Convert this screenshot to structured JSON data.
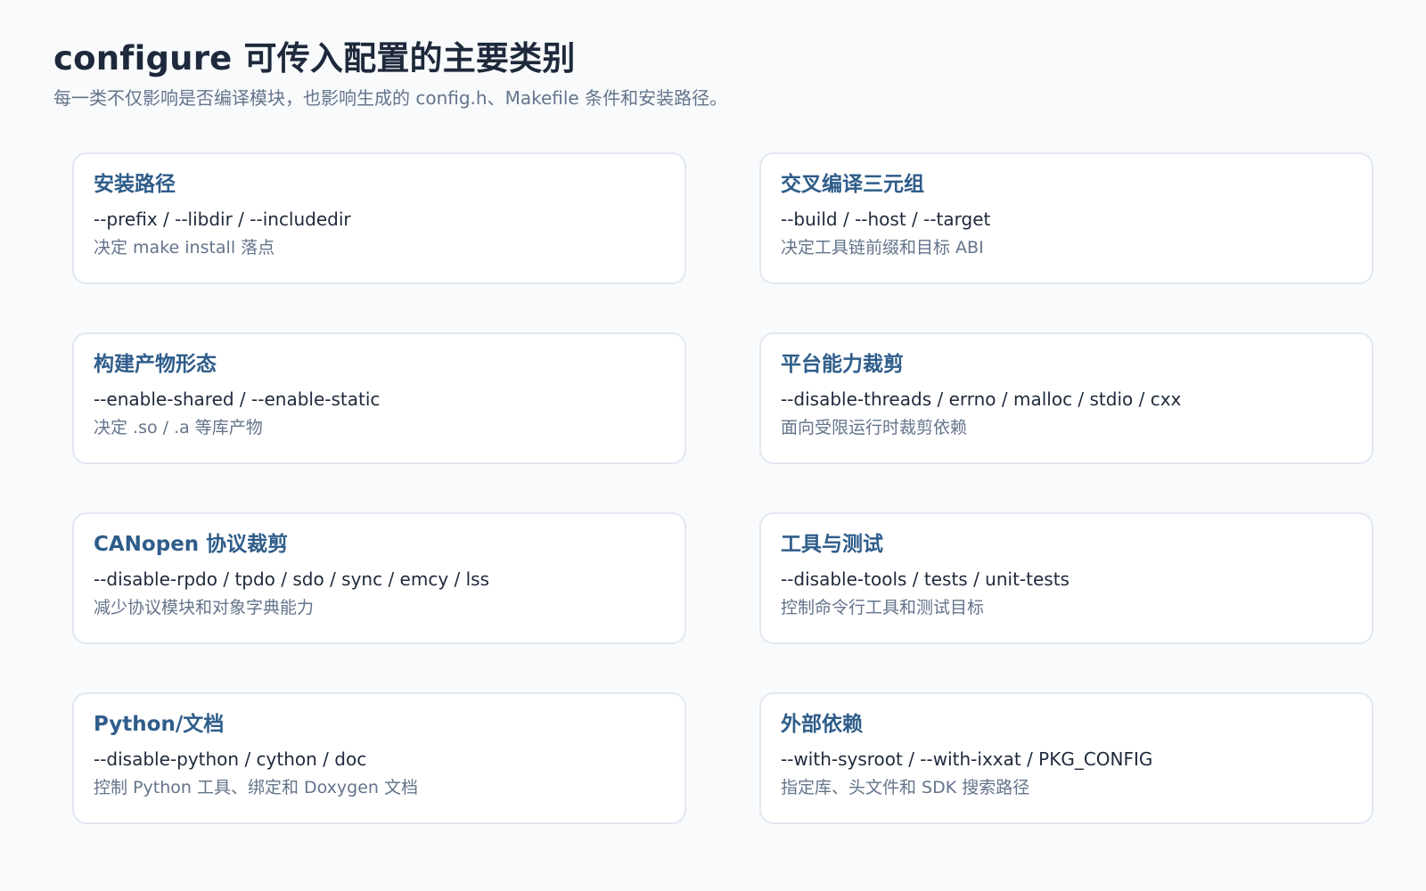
{
  "header": {
    "title": "configure 可传入配置的主要类别",
    "subtitle": "每一类不仅影响是否编译模块，也影响生成的 config.h、Makefile 条件和安装路径。"
  },
  "cards": [
    {
      "title": "安装路径",
      "options": "--prefix / --libdir / --includedir",
      "desc": "决定 make install 落点"
    },
    {
      "title": "交叉编译三元组",
      "options": "--build / --host / --target",
      "desc": "决定工具链前缀和目标 ABI"
    },
    {
      "title": "构建产物形态",
      "options": "--enable-shared / --enable-static",
      "desc": "决定 .so / .a 等库产物"
    },
    {
      "title": "平台能力裁剪",
      "options": "--disable-threads / errno / malloc / stdio / cxx",
      "desc": "面向受限运行时裁剪依赖"
    },
    {
      "title": "CANopen 协议裁剪",
      "options": "--disable-rpdo / tpdo / sdo / sync / emcy / lss",
      "desc": "减少协议模块和对象字典能力"
    },
    {
      "title": "工具与测试",
      "options": "--disable-tools / tests / unit-tests",
      "desc": "控制命令行工具和测试目标"
    },
    {
      "title": "Python/文档",
      "options": "--disable-python / cython / doc",
      "desc": "控制 Python 工具、绑定和 Doxygen 文档"
    },
    {
      "title": "外部依赖",
      "options": "--with-sysroot / --with-ixxat / PKG_CONFIG",
      "desc": "指定库、头文件和 SDK 搜索路径"
    }
  ]
}
